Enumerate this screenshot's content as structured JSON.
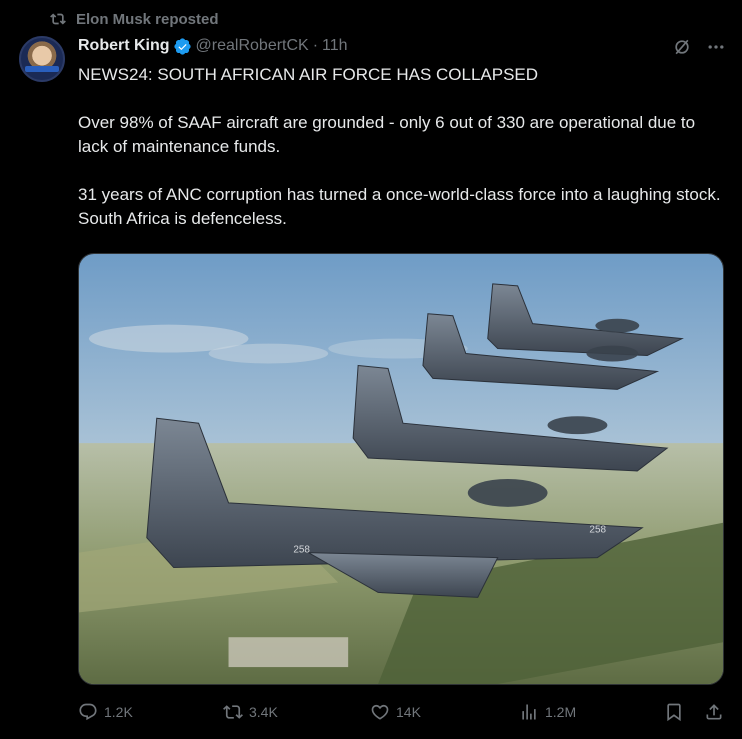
{
  "repost": {
    "label": "Elon Musk reposted"
  },
  "author": {
    "name": "Robert King",
    "handle": "@realRobertCK",
    "separator": "·",
    "time": "11h"
  },
  "post": {
    "paragraphs": [
      "NEWS24: SOUTH AFRICAN AIR FORCE HAS COLLAPSED",
      "Over 98% of SAAF aircraft are grounded - only 6 out of 330 are operational due to lack of maintenance funds.",
      "31 years of ANC corruption has turned a once-world-class force into a laughing stock. South Africa is defenceless."
    ]
  },
  "media": {
    "jet_tail_numbers": [
      "258",
      "258"
    ]
  },
  "actions": {
    "replies": "1.2K",
    "reposts": "3.4K",
    "likes": "14K",
    "views": "1.2M"
  },
  "colors": {
    "background": "#000000",
    "text": "#e7e9ea",
    "muted": "#71767b",
    "verified": "#1d9bf0"
  }
}
